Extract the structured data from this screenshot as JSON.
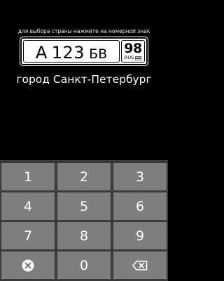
{
  "hint": "для выбора страны нажмите на номерной знак",
  "plate": {
    "letter1": "А",
    "digits": "123",
    "letters2": "БВ",
    "region": "98",
    "country": "RUS",
    "flag_colors": [
      "#ffffff",
      "#1c3f95",
      "#e4181c"
    ]
  },
  "city": "город Санкт-Петербург",
  "keypad": {
    "keys": [
      "1",
      "2",
      "3",
      "4",
      "5",
      "6",
      "7",
      "8",
      "9"
    ],
    "zero": "0",
    "clear_icon": "close-circle-icon",
    "backspace_icon": "backspace-icon"
  },
  "colors": {
    "background": "#000000",
    "keypad_panel": "#3a3a3a",
    "key": "#7e7e7e"
  }
}
